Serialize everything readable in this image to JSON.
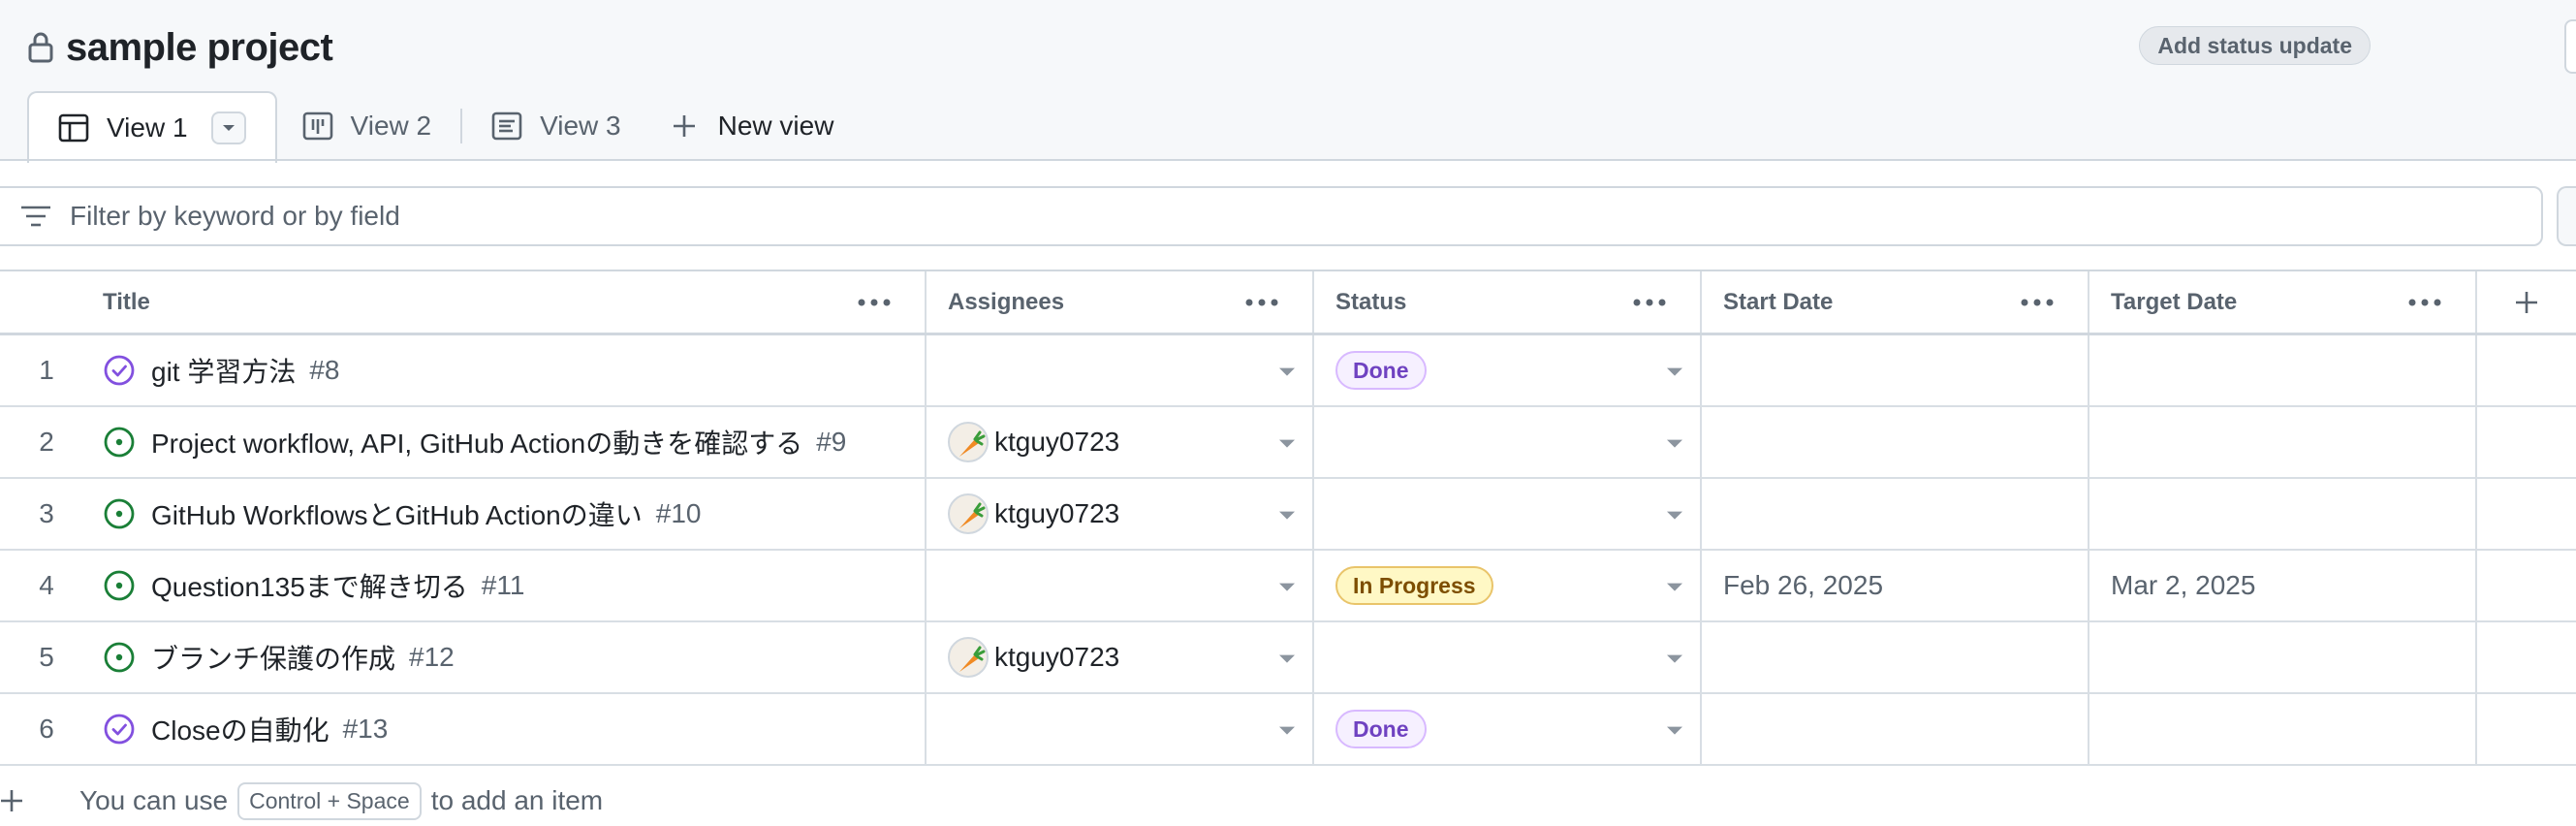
{
  "header": {
    "project_title": "sample project",
    "status_update_label": "Add status update"
  },
  "tabs": [
    {
      "label": "View 1",
      "icon": "table-icon",
      "active": true
    },
    {
      "label": "View 2",
      "icon": "board-icon",
      "active": false
    },
    {
      "label": "View 3",
      "icon": "roadmap-icon",
      "active": false
    }
  ],
  "new_view_label": "New view",
  "filter": {
    "placeholder": "Filter by keyword or by field"
  },
  "columns": {
    "title": "Title",
    "assignees": "Assignees",
    "status": "Status",
    "start_date": "Start Date",
    "target_date": "Target Date"
  },
  "rows": [
    {
      "num": "1",
      "state": "closed",
      "title": "git 学習方法",
      "issue": "#8",
      "assignee": "",
      "status": "Done",
      "start": "",
      "target": ""
    },
    {
      "num": "2",
      "state": "open",
      "title": "Project workflow, API, GitHub Actionの動きを確認する",
      "issue": "#9",
      "assignee": "ktguy0723",
      "status": "",
      "start": "",
      "target": ""
    },
    {
      "num": "3",
      "state": "open",
      "title": "GitHub WorkflowsとGitHub Actionの違い",
      "issue": "#10",
      "assignee": "ktguy0723",
      "status": "",
      "start": "",
      "target": ""
    },
    {
      "num": "4",
      "state": "open",
      "title": "Question135まで解き切る",
      "issue": "#11",
      "assignee": "",
      "status": "In Progress",
      "start": "Feb 26, 2025",
      "target": "Mar 2, 2025"
    },
    {
      "num": "5",
      "state": "open",
      "title": "ブランチ保護の作成",
      "issue": "#12",
      "assignee": "ktguy0723",
      "status": "",
      "start": "",
      "target": ""
    },
    {
      "num": "6",
      "state": "closed",
      "title": "Closeの自動化",
      "issue": "#13",
      "assignee": "",
      "status": "Done",
      "start": "",
      "target": ""
    }
  ],
  "footer": {
    "prefix": "You can use",
    "kbd": "Control + Space",
    "suffix": "to add an item"
  },
  "colors": {
    "open": "#1a7f37",
    "closed": "#8250df",
    "done_text": "#6f42c1",
    "progress_text": "#7d4e00"
  }
}
